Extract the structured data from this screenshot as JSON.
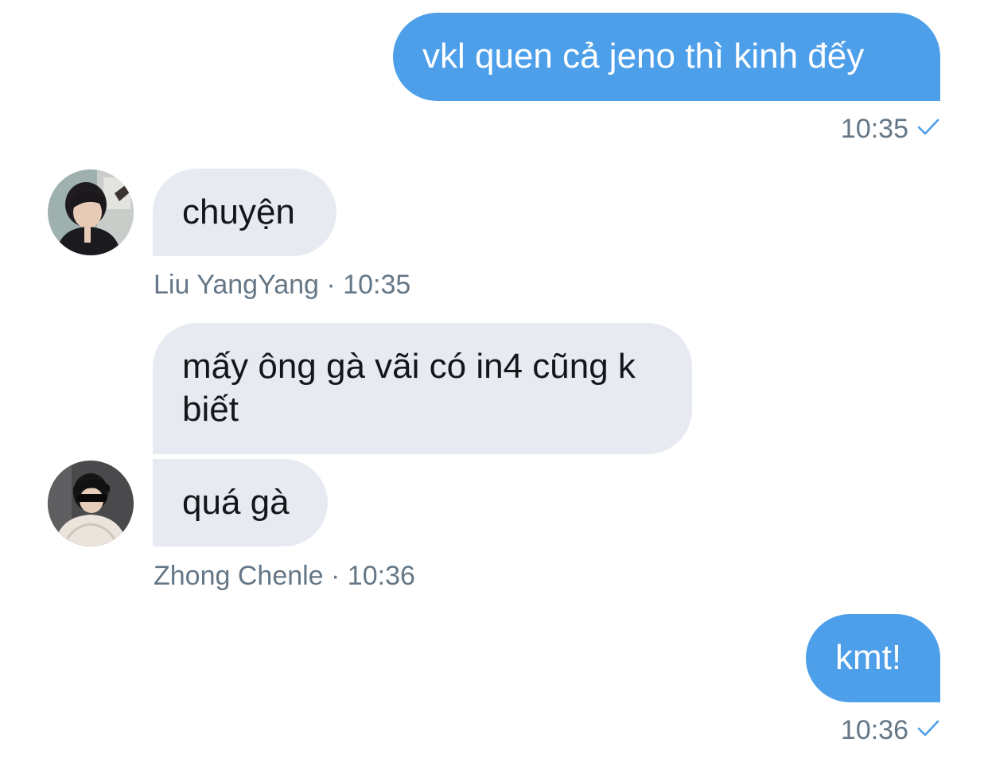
{
  "conversation": {
    "messages": [
      {
        "direction": "outgoing",
        "text": "vkl quen cả jeno thì kinh đếy",
        "time": "10:35"
      },
      {
        "direction": "incoming",
        "sender": "Liu YangYang",
        "text": "chuyện",
        "time": "10:35"
      },
      {
        "direction": "incoming",
        "sender": "Zhong Chenle",
        "text": "mấy ông gà vãi có in4 cũng k biết"
      },
      {
        "direction": "incoming",
        "sender": "Zhong Chenle",
        "text": "quá gà",
        "time": "10:36"
      },
      {
        "direction": "outgoing",
        "text": "kmt!",
        "time": "10:36"
      }
    ],
    "meta": {
      "msg1": "10:35",
      "msg2": "Liu YangYang · 10:35",
      "msg4": "Zhong Chenle · 10:36",
      "msg5": "10:36"
    }
  },
  "icons": {
    "read_receipt": "checkmark-icon",
    "avatar_1": "avatar-liu-yangyang",
    "avatar_2": "avatar-zhong-chenle"
  },
  "colors": {
    "outgoing_bubble": "#4d9fea",
    "incoming_bubble": "#e7eaf1",
    "meta_text": "#657786",
    "checkmark": "#4d9fea"
  }
}
